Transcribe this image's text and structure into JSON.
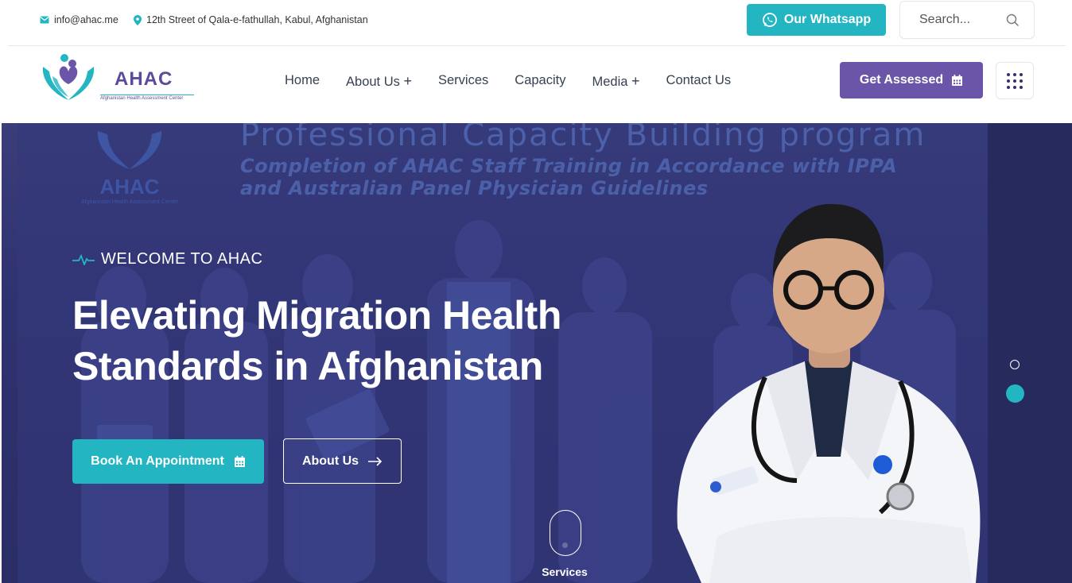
{
  "topbar": {
    "email": "info@ahac.me",
    "address": "12th Street of Qala-e-fathullah, Kabul, Afghanistan",
    "whatsapp_label": "Our Whatsapp",
    "search_placeholder": "Search..."
  },
  "logo": {
    "brand": "AHAC",
    "tagline": "Afghanistan Health Assessment Center"
  },
  "nav": {
    "items": [
      {
        "label": "Home",
        "has_submenu": false
      },
      {
        "label": "About Us",
        "has_submenu": true
      },
      {
        "label": "Services",
        "has_submenu": false
      },
      {
        "label": "Capacity",
        "has_submenu": false
      },
      {
        "label": "Media",
        "has_submenu": true
      },
      {
        "label": "Contact Us",
        "has_submenu": false
      }
    ],
    "submenu_glyph": "+",
    "cta_label": "Get Assessed"
  },
  "hero": {
    "banner": {
      "line1": "Professional Capacity Building program",
      "line2": "Completion of AHAC Staff Training in Accordance with IPPA",
      "line3": "and Australian Panel Physician Guidelines",
      "logo_text": "AHAC",
      "logo_sub": "Afghanistan Health Assessment Center"
    },
    "eyebrow": "WELCOME TO AHAC",
    "headline_line1": "Elevating Migration Health",
    "headline_line2": "Standards in Afghanistan",
    "primary_button": "Book An Appointment",
    "secondary_button": "About Us",
    "scroll_label": "Services"
  },
  "colors": {
    "teal": "#23b5c2",
    "purple": "#6a55a8",
    "hero_overlay": "#2f3270"
  },
  "icons": {
    "email": "envelope-icon",
    "address": "map-pin-icon",
    "whatsapp": "whatsapp-icon",
    "search": "search-icon",
    "calendar": "calendar-icon",
    "grid": "grid-dots-icon",
    "pulse": "heartbeat-icon",
    "arrow": "arrow-right-icon"
  }
}
